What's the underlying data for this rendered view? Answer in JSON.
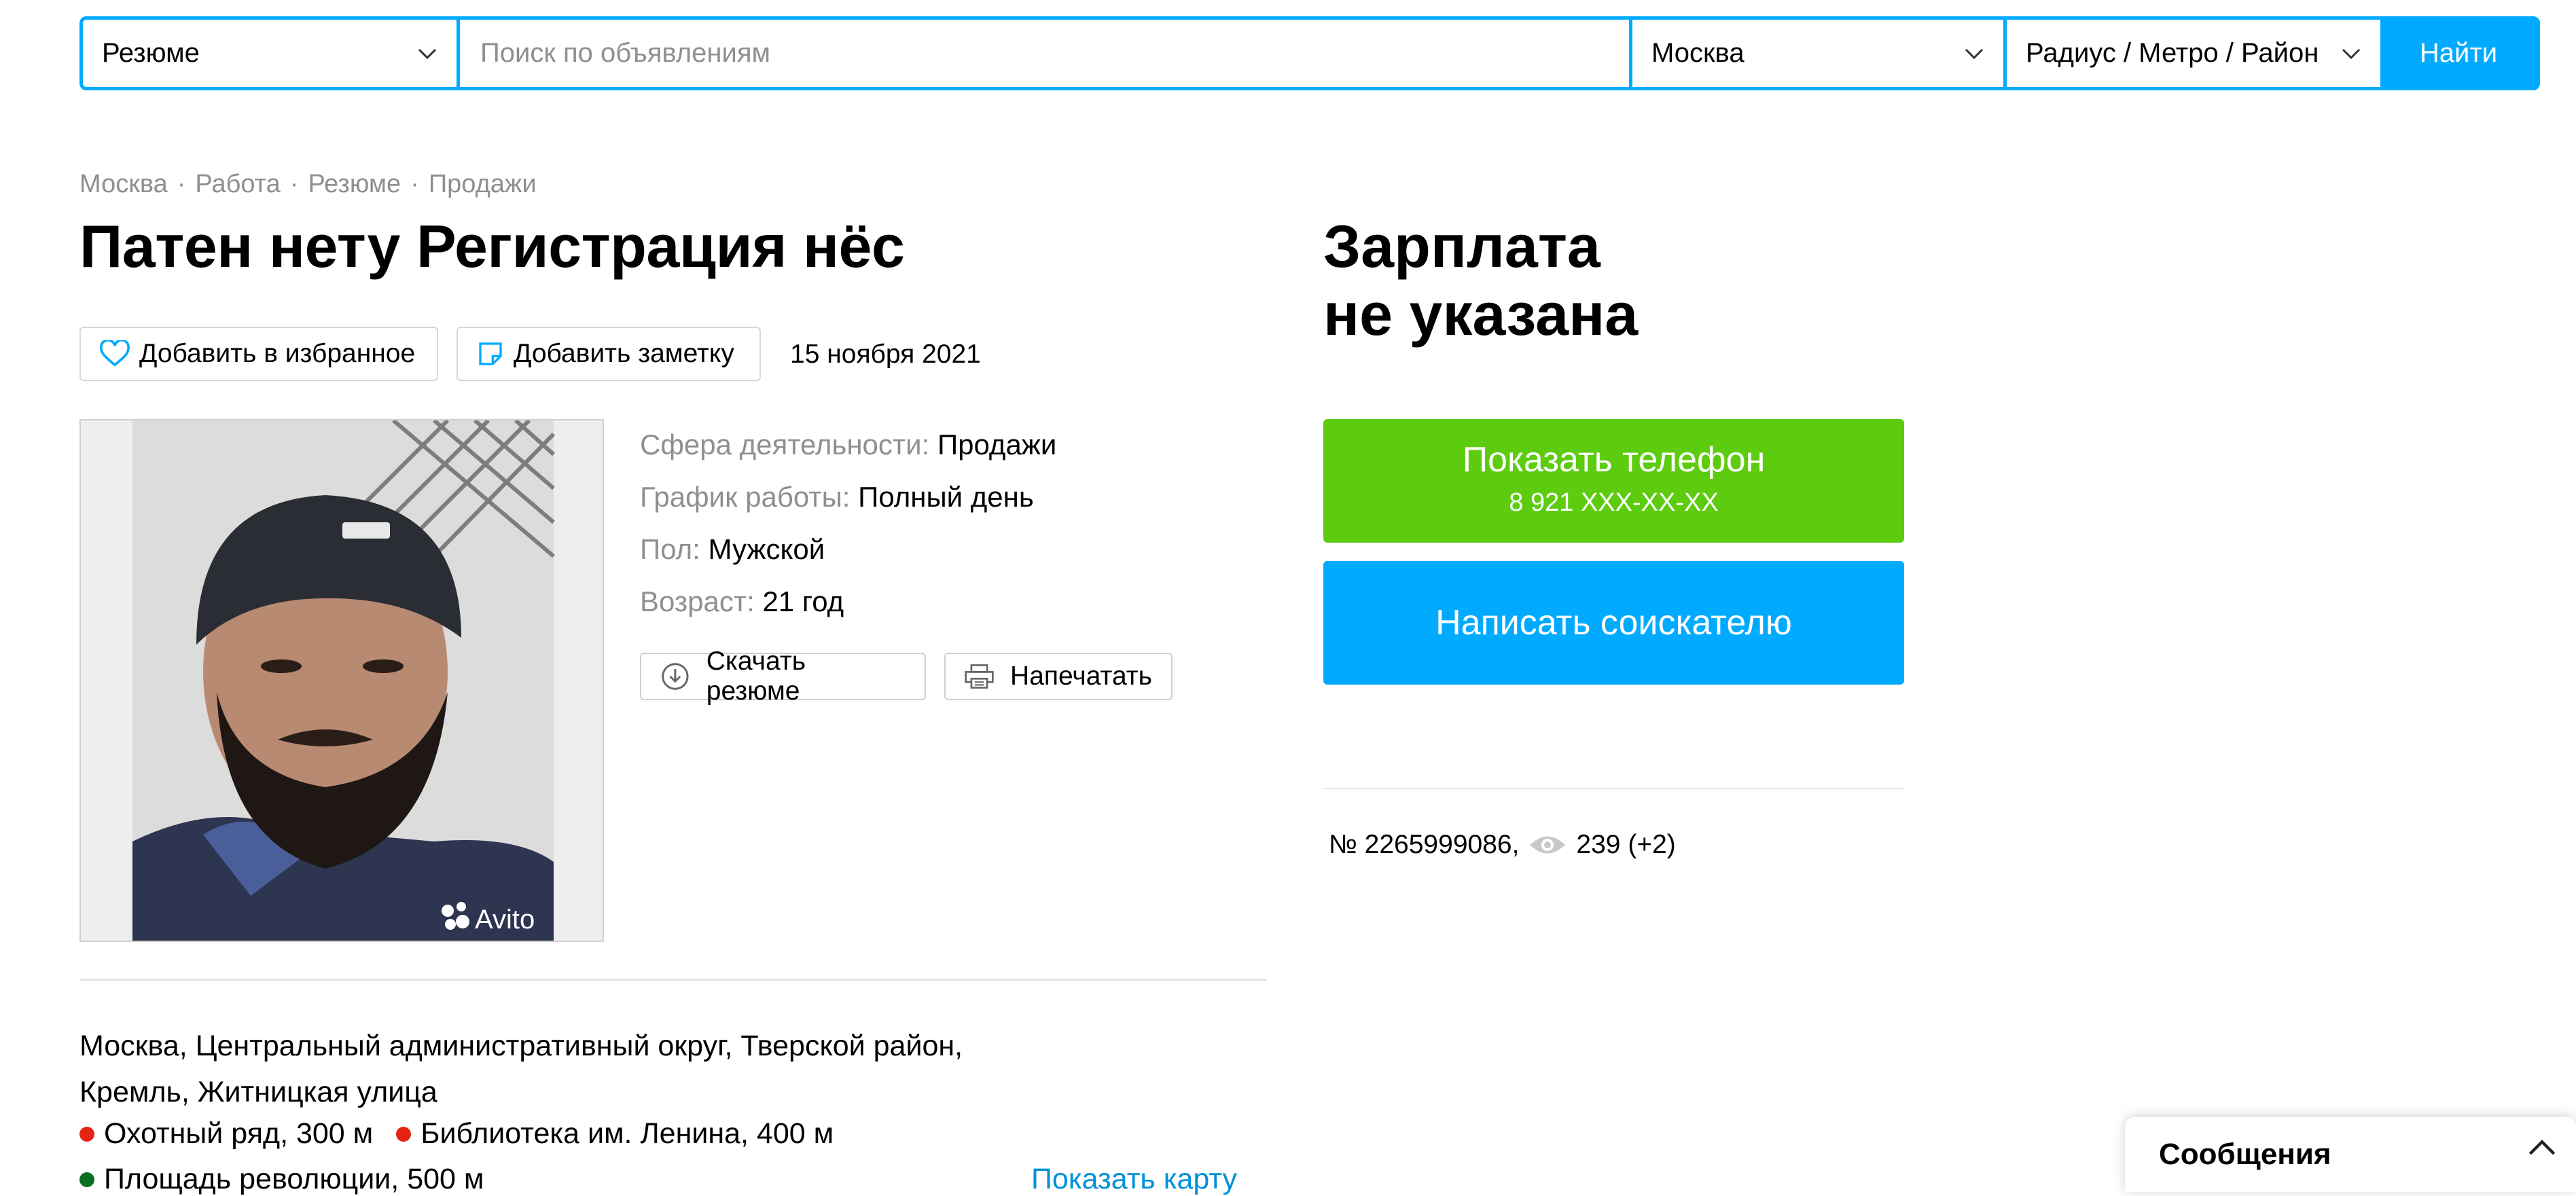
{
  "search": {
    "category": "Резюме",
    "query_placeholder": "Поиск по объявлениям",
    "city": "Москва",
    "radius": "Радиус / Метро / Район",
    "submit_label": "Найти"
  },
  "breadcrumb": [
    "Москва",
    "Работа",
    "Резюме",
    "Продажи"
  ],
  "title": "Патен нету Регистрация нёс",
  "actions": {
    "favorite_label": "Добавить в избранное",
    "note_label": "Добавить заметку",
    "date": "15 ноября 2021"
  },
  "params": [
    {
      "label": "Сфера деятельности:",
      "value": "Продажи"
    },
    {
      "label": "График работы:",
      "value": "Полный день"
    },
    {
      "label": "Пол:",
      "value": "Мужской"
    },
    {
      "label": "Возраст:",
      "value": "21 год"
    }
  ],
  "resume_actions": {
    "download_label": "Скачать резюме",
    "print_label": "Напечатать"
  },
  "photo": {
    "watermark": "Avito"
  },
  "salary": {
    "line1": "Зарплата",
    "line2": "не указана"
  },
  "contact": {
    "phone_label": "Показать телефон",
    "phone_masked": "8 921 XXX-XX-XX",
    "write_label": "Написать соискателю"
  },
  "stats": {
    "item_number": "№ 2265999086,",
    "views": "239 (+2)"
  },
  "address": {
    "line1": "Москва, Центральный административный округ, Тверской район,",
    "line2": "Кремль, Житницкая улица",
    "metro": [
      {
        "name": "Охотный ряд, 300 м",
        "color": "#e42313"
      },
      {
        "name": "Библиотека им. Ленина, 400 м",
        "color": "#e42313"
      },
      {
        "name": "Площадь революции, 500 м",
        "color": "#0a6f20"
      }
    ],
    "show_map_label": "Показать карту"
  },
  "messages": {
    "label": "Сообщения"
  },
  "colors": {
    "accent": "#00aaff",
    "phone_button": "#5dcc0f",
    "muted_text": "#8f8f8f"
  }
}
